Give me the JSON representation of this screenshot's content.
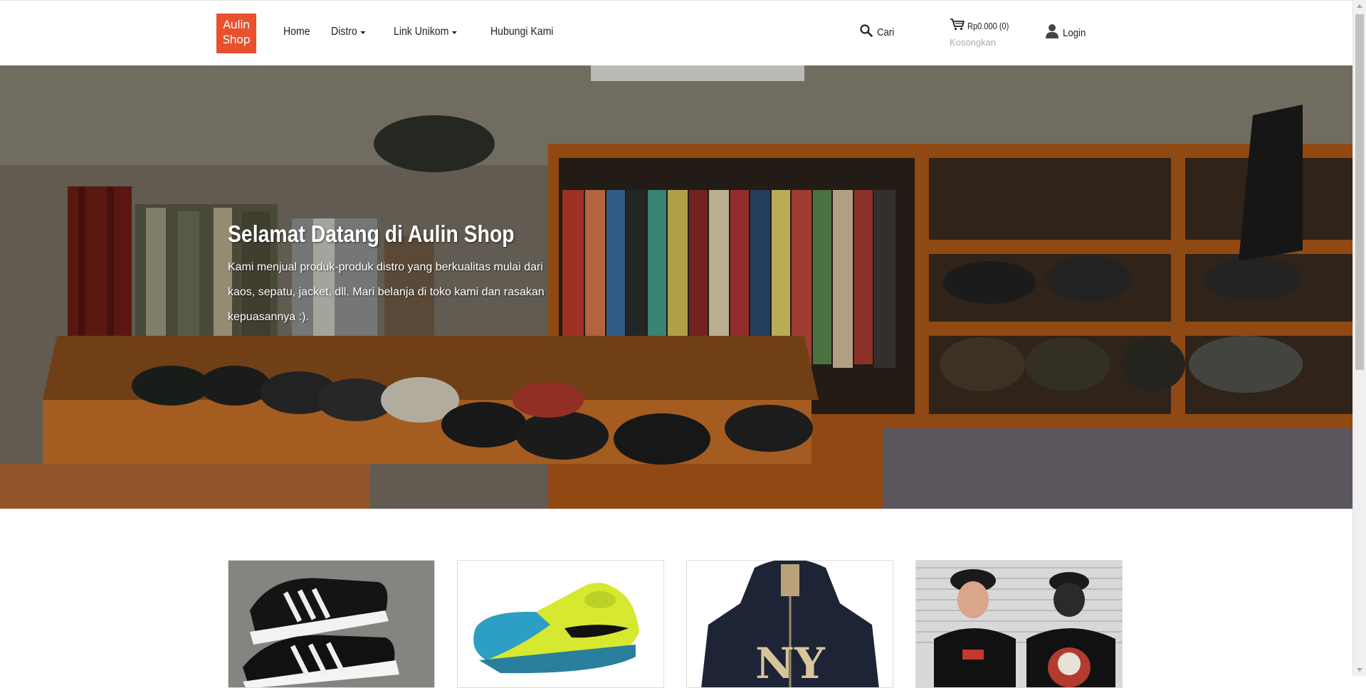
{
  "header": {
    "logo_line1": "Aulin",
    "logo_line2": "Shop",
    "nav": [
      {
        "label": "Home",
        "dropdown": false
      },
      {
        "label": "Distro",
        "dropdown": true
      },
      {
        "label": "Link Unikom",
        "dropdown": true
      },
      {
        "label": "Hubungi Kami",
        "dropdown": false
      }
    ],
    "search_label": "Cari",
    "search_icon": "search-icon",
    "cart_icon": "shopping-cart-icon",
    "cart_total": "Rp0.000 (0)",
    "cart_empty_label": "Kosongkan",
    "login_icon": "user-icon",
    "login_label": "Login"
  },
  "hero": {
    "title": "Selamat Datang di Aulin Shop",
    "text": "Kami menjual produk-produk distro yang berkualitas mulai dari kaos, sepatu, jacket, dll. Mari belanja di toko kami dan rasakan kepuasannya :)."
  },
  "products": [
    {
      "image": "black-white-sneakers"
    },
    {
      "image": "green-futsal-shoe"
    },
    {
      "image": "navy-ny-hoodie"
    },
    {
      "image": "black-graphic-tshirt"
    }
  ],
  "colors": {
    "brand": "#e8502e",
    "text": "#222222",
    "muted": "#aaaaaa"
  }
}
